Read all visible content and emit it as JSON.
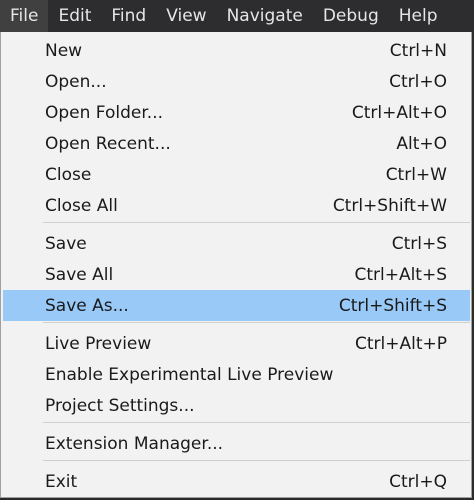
{
  "menubar": [
    {
      "label": "File",
      "active": true
    },
    {
      "label": "Edit"
    },
    {
      "label": "Find"
    },
    {
      "label": "View"
    },
    {
      "label": "Navigate"
    },
    {
      "label": "Debug"
    },
    {
      "label": "Help"
    }
  ],
  "file_menu": {
    "groups": [
      [
        {
          "label": "New",
          "shortcut": "Ctrl+N"
        },
        {
          "label": "Open...",
          "shortcut": "Ctrl+O"
        },
        {
          "label": "Open Folder...",
          "shortcut": "Ctrl+Alt+O"
        },
        {
          "label": "Open Recent...",
          "shortcut": "Alt+O"
        },
        {
          "label": "Close",
          "shortcut": "Ctrl+W"
        },
        {
          "label": "Close All",
          "shortcut": "Ctrl+Shift+W"
        }
      ],
      [
        {
          "label": "Save",
          "shortcut": "Ctrl+S"
        },
        {
          "label": "Save All",
          "shortcut": "Ctrl+Alt+S"
        },
        {
          "label": "Save As...",
          "shortcut": "Ctrl+Shift+S",
          "highlighted": true
        }
      ],
      [
        {
          "label": "Live Preview",
          "shortcut": "Ctrl+Alt+P"
        },
        {
          "label": "Enable Experimental Live Preview",
          "shortcut": ""
        },
        {
          "label": "Project Settings...",
          "shortcut": ""
        }
      ],
      [
        {
          "label": "Extension Manager...",
          "shortcut": ""
        }
      ],
      [
        {
          "label": "Exit",
          "shortcut": "Ctrl+Q"
        }
      ]
    ]
  },
  "colors": {
    "menubar_bg": "#2d2d30",
    "menu_bg": "#f2f2f2",
    "highlight": "#99c9f7"
  }
}
